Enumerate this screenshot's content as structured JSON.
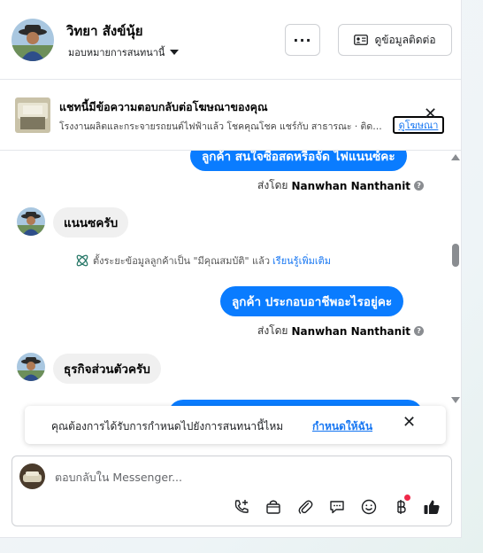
{
  "header": {
    "contact_name": "วิทยา สังข์นุ้ย",
    "assignee_label": "มอบหมายการสนทนานี้",
    "more_label": "···",
    "contact_info_label": "ดูข้อมูลติดต่อ"
  },
  "ad_reply": {
    "title": "แชทนี้มีข้อความตอบกลับต่อโฆษณาของคุณ",
    "subtitle": "โรงงานผลิตและกระจายรถยนต์ไฟฟ้าแล้ว โชคคุณโชค แชร์กับ สาธารณะ · ติดตามรถยนต์ไฟฟ้า",
    "link_label": "ดูโฆษณา",
    "close_label": "✕"
  },
  "thread": {
    "messages": [
      {
        "text": "ลูกค้า สนใจซื้อสดหรือจัด ไฟแนนซ์คะ"
      },
      {
        "text": "แนนซครับ"
      },
      {
        "text": "ลูกค้า  ประกอบอาชีพอะไรอยู่คะ"
      },
      {
        "text": "ธุรกิจส่วนตัวครับ"
      }
    ],
    "sent_by_prefix": "ส่งโดย",
    "sent_by_name": "Nanwhan Nanthanit",
    "info_glyph": "?",
    "system_note": "ตั้งระยะข้อมูลลูกค้าเป็น \"มีคุณสมบัติ\" แล้ว",
    "system_link": "เรียนรู้เพิ่มเติม"
  },
  "assign_banner": {
    "text": "คุณต้องการได้รับการกำหนดไปยังการสนทนานี้ไหม",
    "link_label": "กำหนดให้ฉัน",
    "close_label": "✕"
  },
  "composer": {
    "placeholder": "ตอบกลับใน Messenger...",
    "value": ""
  },
  "icons": {
    "call": "phone-add-icon",
    "shop": "shopping-bag-icon",
    "attach": "paperclip-icon",
    "saved_reply": "chat-bubble-icon",
    "emoji": "emoji-icon",
    "payment": "baht-icon",
    "like": "thumbs-up-icon"
  },
  "colors": {
    "accent": "#0a7cff",
    "link": "#1877f2",
    "notification": "#f02849"
  }
}
